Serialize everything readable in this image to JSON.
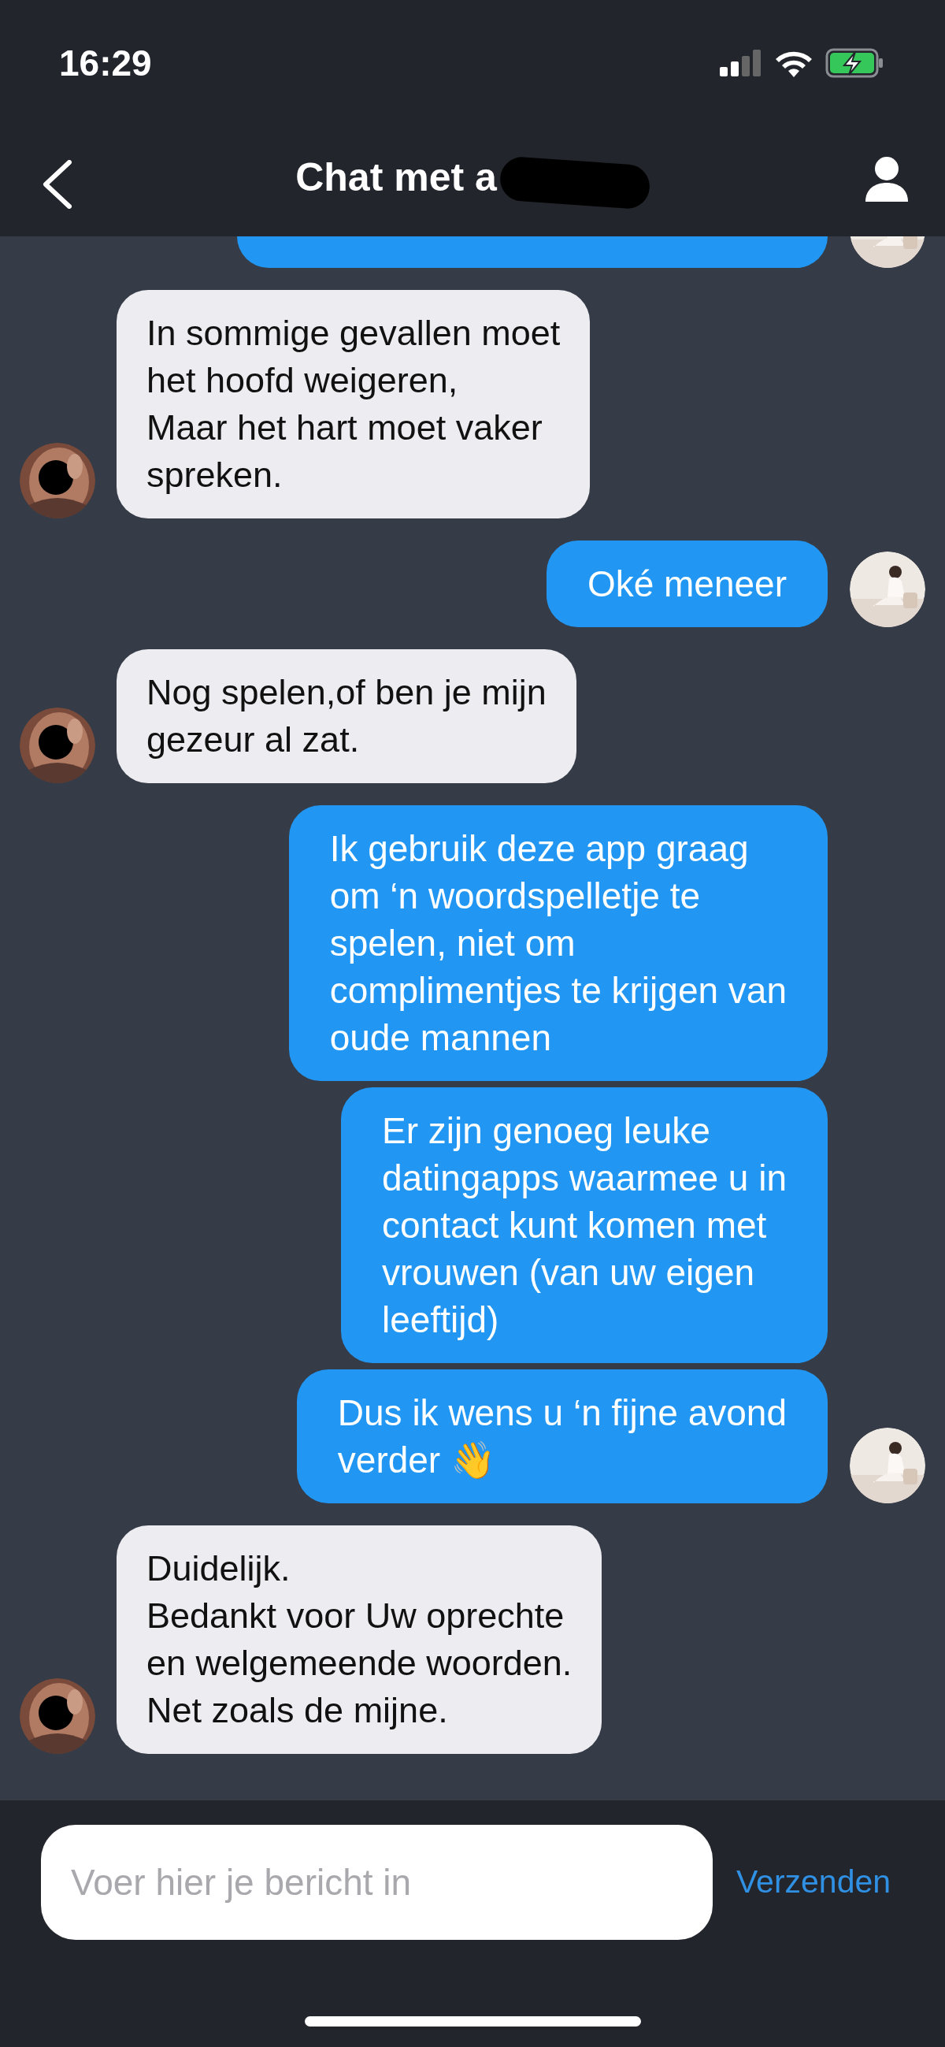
{
  "status_bar": {
    "time": "16:29",
    "charging": true
  },
  "header": {
    "title": "Chat met a",
    "title_redacted": true
  },
  "top_partial_bubble": {
    "kind": "sent",
    "show_avatar": true
  },
  "messages": [
    {
      "kind": "received",
      "text": "In sommige gevallen moet\nhet hoofd weigeren,\nMaar het hart moet vaker\nspreken.",
      "show_avatar": true
    },
    {
      "kind": "sent",
      "text": "Oké meneer",
      "show_avatar": true
    },
    {
      "kind": "received",
      "text": "Nog spelen,of ben je mijn\ngezeur al zat.",
      "show_avatar": true
    },
    {
      "kind": "sent",
      "text": "Ik gebruik deze app graag\nom ‘n woordspelletje te\nspelen, niet om\ncomplimentjes te krijgen van\noude mannen",
      "show_avatar": false
    },
    {
      "kind": "sent",
      "text": "Er zijn genoeg leuke\ndatingapps waarmee u in\ncontact kunt komen met\nvrouwen (van uw eigen\nleeftijd)",
      "show_avatar": false
    },
    {
      "kind": "sent",
      "text": "Dus ik wens u ‘n fijne avond\nverder 👋",
      "show_avatar": true
    },
    {
      "kind": "received",
      "text": "Duidelijk.\nBedankt voor Uw oprechte\nen welgemeende woorden.\nNet zoals de mijne.",
      "show_avatar": true
    }
  ],
  "composer": {
    "placeholder": "Voer hier je bericht in",
    "send_label": "Verzenden"
  }
}
